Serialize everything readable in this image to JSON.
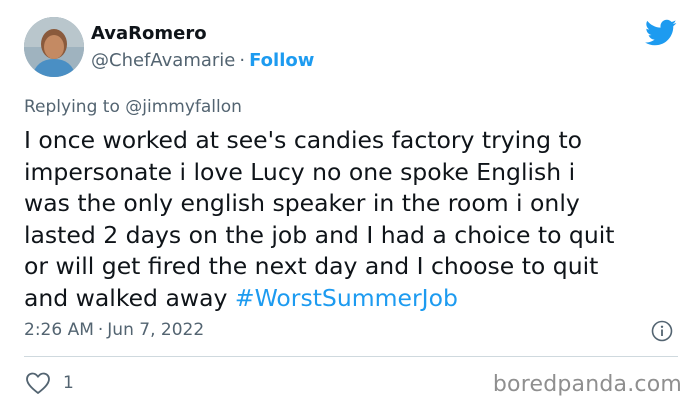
{
  "author": {
    "display_name": "AvaRomero",
    "handle": "@ChefAvamarie",
    "separator": "·",
    "follow_label": "Follow"
  },
  "reply": {
    "prefix": "Replying to",
    "mention": "@jimmyfallon"
  },
  "tweet": {
    "lines": [
      "I once worked at see's candies factory trying to",
      "impersonate i love Lucy no one spoke English i",
      "was the only english speaker in the room i only",
      "lasted 2 days on the job and I had a choice to quit",
      "or will get fired the next day and I choose to quit"
    ],
    "last_line_text": "and walked away",
    "hashtag": "#WorstSummerJob"
  },
  "meta": {
    "time": "2:26 AM",
    "separator": "·",
    "date": "Jun 7, 2022"
  },
  "actions": {
    "like_count": "1"
  },
  "watermark": "boredpanda.com",
  "colors": {
    "link": "#1d9bf0",
    "text": "#0f1419",
    "secondary": "#536471",
    "divider": "#cfd9de"
  },
  "icons": [
    "twitter-bird-icon",
    "info-icon",
    "heart-icon"
  ]
}
